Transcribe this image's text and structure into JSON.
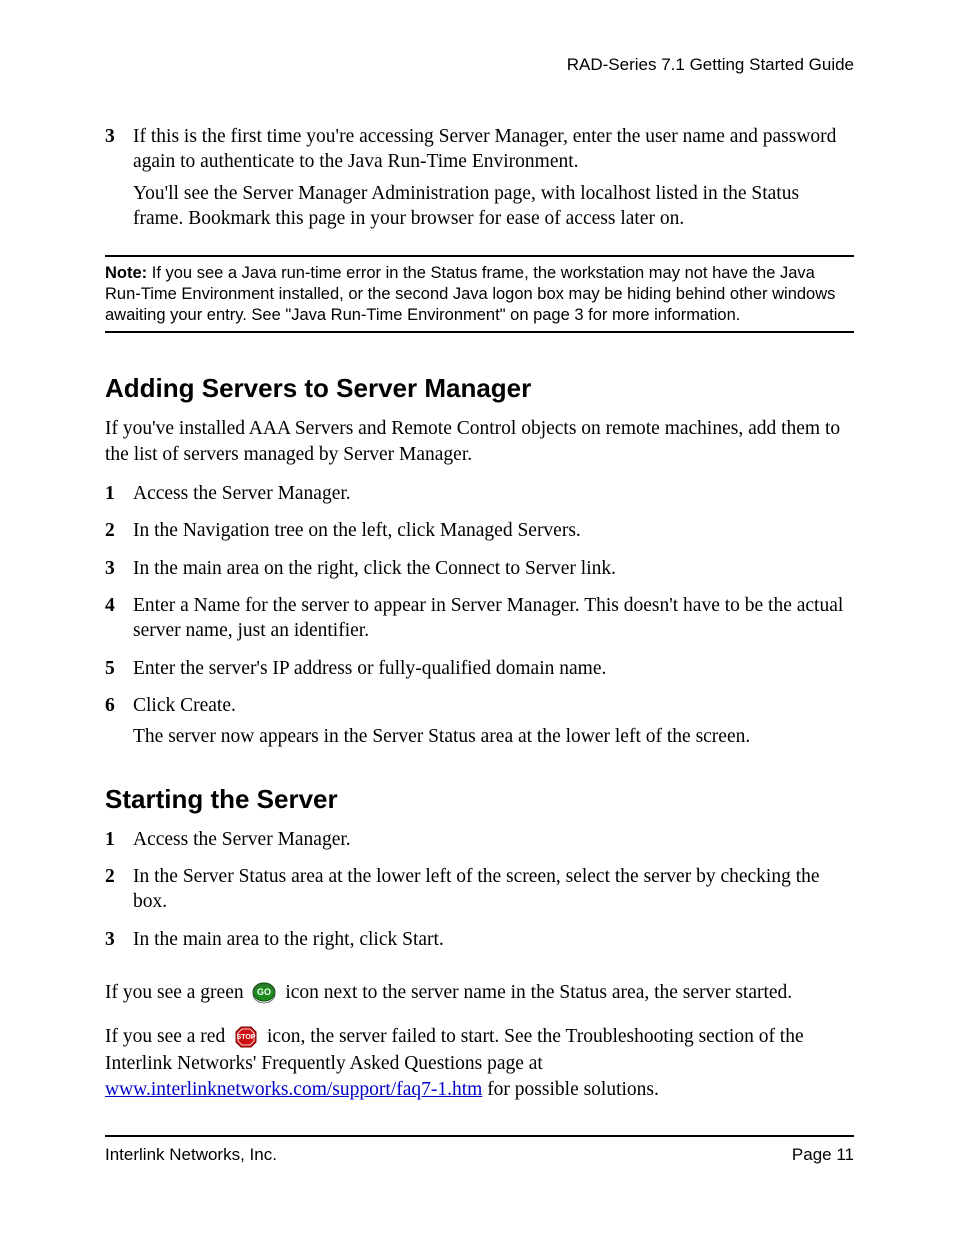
{
  "header": {
    "title": "RAD-Series 7.1 Getting Started Guide"
  },
  "topStep": {
    "num": "3",
    "para1": "If this is the first time you're accessing Server Manager, enter the user name and password again to authenticate to the Java Run-Time Environment.",
    "para2": "You'll see the Server Manager Administration page, with localhost listed in the Status frame. Bookmark this page in your browser for ease of access later on."
  },
  "note": {
    "label": "Note:",
    "text": " If you see a Java run-time error in the Status frame, the workstation may not have the Java Run-Time Environment installed, or the second Java logon box may be hiding behind other windows awaiting your entry. See \"Java Run-Time Environment\" on page 3 for more information."
  },
  "section1": {
    "heading": "Adding Servers to Server Manager",
    "intro": "If you've installed AAA Servers and Remote Control objects on remote machines, add them to the list of servers managed by Server Manager.",
    "steps": [
      {
        "num": "1",
        "text": "Access the Server Manager."
      },
      {
        "num": "2",
        "text": "In the Navigation tree on the left, click Managed Servers."
      },
      {
        "num": "3",
        "text": "In the main area on the right, click the Connect to Server link."
      },
      {
        "num": "4",
        "text": "Enter a Name for the server to appear in Server Manager. This doesn't have to be the actual server name, just an identifier."
      },
      {
        "num": "5",
        "text": "Enter the server's IP address or fully-qualified domain name."
      },
      {
        "num": "6",
        "text": "Click Create.",
        "after": "The server now appears in the Server Status area at the lower left of the screen."
      }
    ]
  },
  "section2": {
    "heading": "Starting the Server",
    "steps": [
      {
        "num": "1",
        "text": "Access the Server Manager."
      },
      {
        "num": "2",
        "text": "In the Server Status area at the lower left of the screen, select the server by checking the box."
      },
      {
        "num": "3",
        "text": "In the main area to the right, click Start."
      }
    ],
    "greenLine": {
      "before": "If you see a green ",
      "after": " icon next to the server name in the Status area, the server started."
    },
    "redLine": {
      "before": "If you see a red ",
      "mid": " icon, the server failed to start. See the Troubleshooting section of the Interlink Networks' Frequently Asked Questions page at ",
      "link": "www.interlinknetworks.com/support/faq7-1.htm",
      "after": " for possible solutions."
    }
  },
  "footer": {
    "left": "Interlink Networks, Inc.",
    "right": "Page 11"
  }
}
